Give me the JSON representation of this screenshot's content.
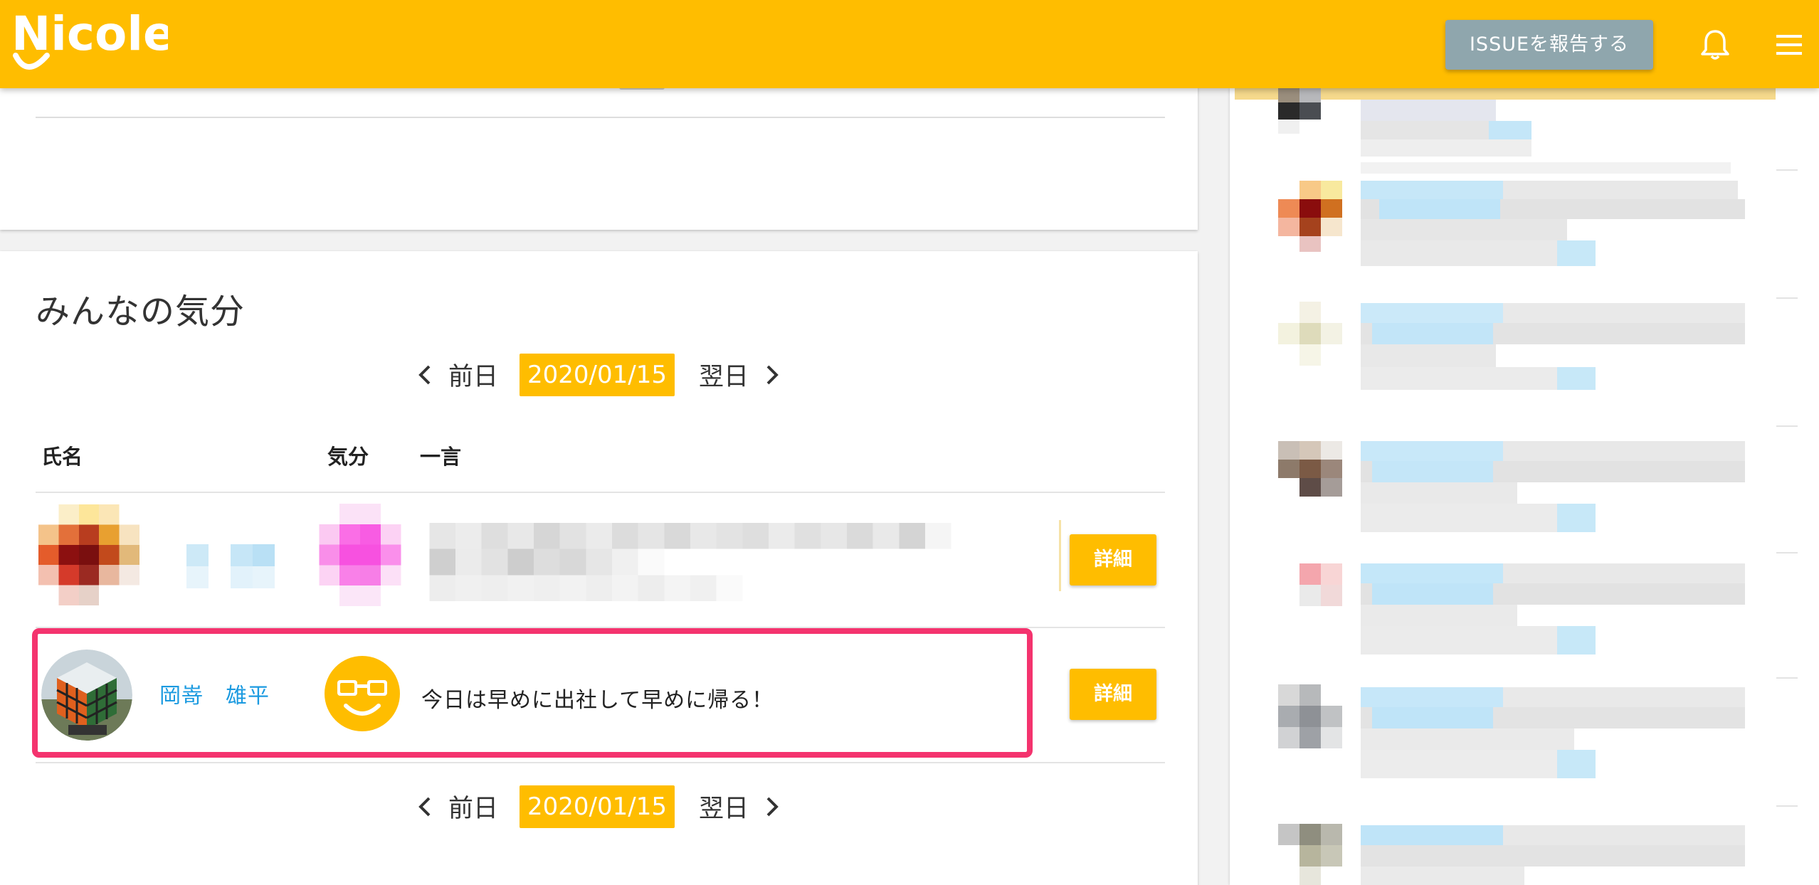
{
  "header": {
    "logo_text": "Nicole",
    "issue_button": "ISSUEを報告する",
    "brand_color": "#ffbd00"
  },
  "mood": {
    "title": "みんなの気分",
    "nav": {
      "prev": "前日",
      "date": "2020/01/15",
      "next": "翌日"
    },
    "columns": {
      "name": "氏名",
      "mood": "気分",
      "comment": "一言"
    },
    "rows": [
      {
        "name": "",
        "comment": "",
        "detail": "詳細",
        "blurred": true
      },
      {
        "name": "岡嵜　雄平",
        "mood_icon": "smiling-glasses-face-icon",
        "comment": "今日は早めに出社して早めに帰る！",
        "detail": "詳細",
        "highlighted": true
      }
    ]
  },
  "colors": {
    "highlight": "#f4336e",
    "link": "#1b9ae0",
    "issue_button": "#8fa6ad"
  }
}
